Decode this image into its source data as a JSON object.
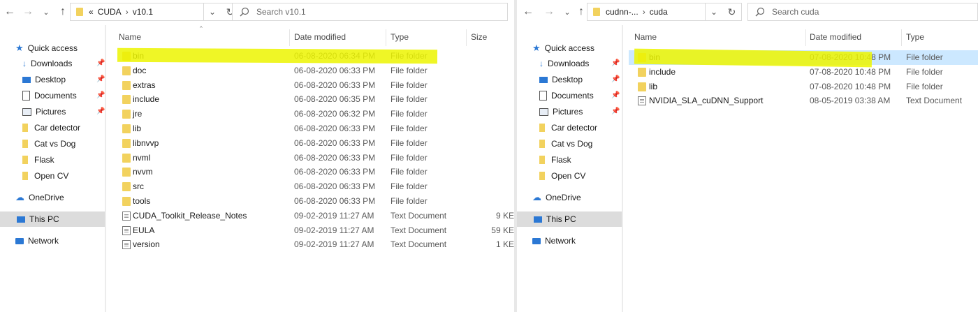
{
  "left": {
    "nav": {
      "back": "←",
      "forward": "→",
      "recent": "⌄",
      "up": "↑"
    },
    "address": {
      "overflow": "«",
      "crumbs": [
        "CUDA",
        "v10.1"
      ]
    },
    "search": {
      "placeholder": "Search v10.1"
    },
    "columns": {
      "name": "Name",
      "date": "Date modified",
      "type": "Type",
      "size": "Size"
    },
    "files": [
      {
        "name": "bin",
        "date": "06-08-2020 06:34 PM",
        "type": "File folder",
        "size": "",
        "kind": "folder"
      },
      {
        "name": "doc",
        "date": "06-08-2020 06:33 PM",
        "type": "File folder",
        "size": "",
        "kind": "folder"
      },
      {
        "name": "extras",
        "date": "06-08-2020 06:33 PM",
        "type": "File folder",
        "size": "",
        "kind": "folder"
      },
      {
        "name": "include",
        "date": "06-08-2020 06:35 PM",
        "type": "File folder",
        "size": "",
        "kind": "folder"
      },
      {
        "name": "jre",
        "date": "06-08-2020 06:32 PM",
        "type": "File folder",
        "size": "",
        "kind": "folder"
      },
      {
        "name": "lib",
        "date": "06-08-2020 06:33 PM",
        "type": "File folder",
        "size": "",
        "kind": "folder"
      },
      {
        "name": "libnvvp",
        "date": "06-08-2020 06:33 PM",
        "type": "File folder",
        "size": "",
        "kind": "folder"
      },
      {
        "name": "nvml",
        "date": "06-08-2020 06:33 PM",
        "type": "File folder",
        "size": "",
        "kind": "folder"
      },
      {
        "name": "nvvm",
        "date": "06-08-2020 06:33 PM",
        "type": "File folder",
        "size": "",
        "kind": "folder"
      },
      {
        "name": "src",
        "date": "06-08-2020 06:33 PM",
        "type": "File folder",
        "size": "",
        "kind": "folder"
      },
      {
        "name": "tools",
        "date": "06-08-2020 06:33 PM",
        "type": "File folder",
        "size": "",
        "kind": "folder"
      },
      {
        "name": "CUDA_Toolkit_Release_Notes",
        "date": "09-02-2019 11:27 AM",
        "type": "Text Document",
        "size": "9 KE",
        "kind": "doc"
      },
      {
        "name": "EULA",
        "date": "09-02-2019 11:27 AM",
        "type": "Text Document",
        "size": "59 KE",
        "kind": "doc"
      },
      {
        "name": "version",
        "date": "09-02-2019 11:27 AM",
        "type": "Text Document",
        "size": "1 KE",
        "kind": "doc"
      }
    ]
  },
  "right": {
    "nav": {
      "back": "←",
      "forward": "→",
      "recent": "⌄",
      "up": "↑"
    },
    "address": {
      "crumbs": [
        "cudnn-...",
        "cuda"
      ]
    },
    "search": {
      "placeholder": "Search cuda"
    },
    "columns": {
      "name": "Name",
      "date": "Date modified",
      "type": "Type"
    },
    "files": [
      {
        "name": "bin",
        "date": "07-08-2020 10:48 PM",
        "type": "File folder",
        "kind": "folder"
      },
      {
        "name": "include",
        "date": "07-08-2020 10:48 PM",
        "type": "File folder",
        "kind": "folder"
      },
      {
        "name": "lib",
        "date": "07-08-2020 10:48 PM",
        "type": "File folder",
        "kind": "folder"
      },
      {
        "name": "NVIDIA_SLA_cuDNN_Support",
        "date": "08-05-2019 03:38 AM",
        "type": "Text Document",
        "kind": "doc"
      }
    ]
  },
  "sidebar": {
    "quick_access": "Quick access",
    "items": [
      {
        "label": "Downloads",
        "icon": "download-arrow-icon",
        "pinned": true
      },
      {
        "label": "Desktop",
        "icon": "desktop-icon",
        "pinned": true
      },
      {
        "label": "Documents",
        "icon": "documents-icon",
        "pinned": true
      },
      {
        "label": "Pictures",
        "icon": "pictures-icon",
        "pinned": true
      },
      {
        "label": "Car detector",
        "icon": "folder-icon",
        "pinned": false
      },
      {
        "label": "Cat vs Dog",
        "icon": "folder-icon",
        "pinned": false
      },
      {
        "label": "Flask",
        "icon": "folder-icon",
        "pinned": false
      },
      {
        "label": "Open CV",
        "icon": "folder-icon",
        "pinned": false
      }
    ],
    "onedrive": "OneDrive",
    "this_pc": "This PC",
    "network": "Network"
  },
  "colors": {
    "highlight": "#ecf400",
    "selection": "#cce8ff",
    "folder": "#f2d25e",
    "accent": "#1a73c8"
  }
}
